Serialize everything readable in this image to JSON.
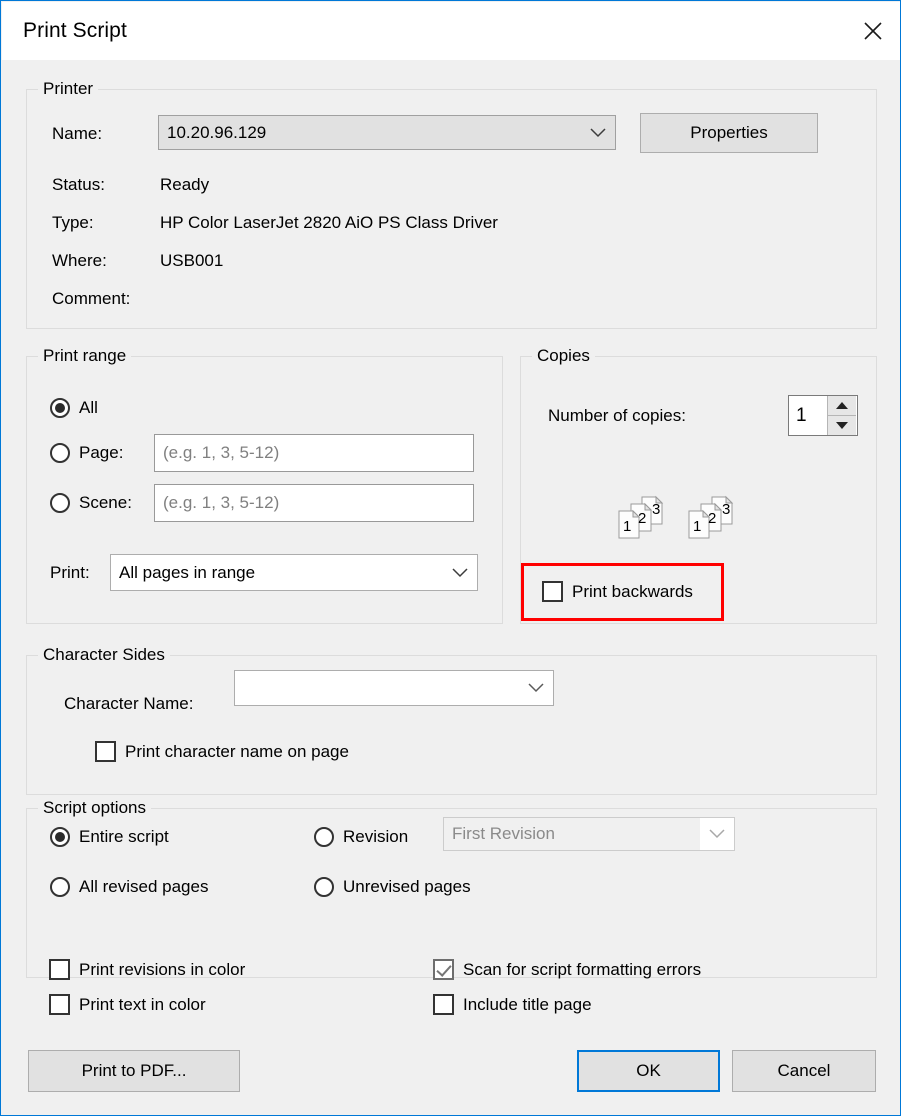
{
  "window": {
    "title": "Print Script",
    "close_icon": "close-icon",
    "accent_color": "#0078d7",
    "background_color": "#f0f0f0",
    "highlight_color": "#ff0000"
  },
  "printer": {
    "group_title": "Printer",
    "name_label": "Name:",
    "name_value": "10.20.96.129",
    "properties_button": "Properties",
    "status_label": "Status:",
    "status_value": "Ready",
    "type_label": "Type:",
    "type_value": "HP Color LaserJet 2820 AiO PS Class Driver",
    "where_label": "Where:",
    "where_value": "USB001",
    "comment_label": "Comment:",
    "comment_value": ""
  },
  "print_range": {
    "group_title": "Print range",
    "options": [
      {
        "label": "All",
        "selected": true
      },
      {
        "label": "Page:",
        "selected": false
      },
      {
        "label": "Scene:",
        "selected": false
      }
    ],
    "page_placeholder": "(e.g. 1, 3, 5-12)",
    "page_value": "",
    "scene_placeholder": "(e.g. 1, 3, 5-12)",
    "scene_value": "",
    "print_label": "Print:",
    "print_value": "All pages in range"
  },
  "copies": {
    "group_title": "Copies",
    "number_label": "Number of copies:",
    "number_value": "1",
    "spinner_up_icon": "triangle-up-icon",
    "spinner_down_icon": "triangle-down-icon",
    "collate_icon": "collate-pages-icon",
    "collate_page_numbers": [
      "1",
      "2",
      "3"
    ],
    "print_backwards_label": "Print backwards",
    "print_backwards_checked": false
  },
  "character_sides": {
    "group_title": "Character Sides",
    "character_name_label": "Character Name:",
    "character_name_value": "",
    "print_character_name_label": "Print character name on page",
    "print_character_name_checked": false
  },
  "script_options": {
    "group_title": "Script options",
    "options": [
      {
        "label": "Entire script",
        "selected": true
      },
      {
        "label": "Revision",
        "selected": false
      },
      {
        "label": "All revised pages",
        "selected": false
      },
      {
        "label": "Unrevised pages",
        "selected": false
      }
    ],
    "revision_value": "First Revision",
    "revision_disabled": true
  },
  "extra_options": {
    "print_revisions_in_color": {
      "label": "Print revisions in color",
      "checked": false
    },
    "print_text_in_color": {
      "label": "Print text in color",
      "checked": false
    },
    "scan_for_errors": {
      "label": "Scan for script formatting errors",
      "checked": true
    },
    "include_title_page": {
      "label": "Include title page",
      "checked": false
    }
  },
  "footer": {
    "print_to_pdf": "Print to PDF...",
    "ok": "OK",
    "cancel": "Cancel"
  }
}
